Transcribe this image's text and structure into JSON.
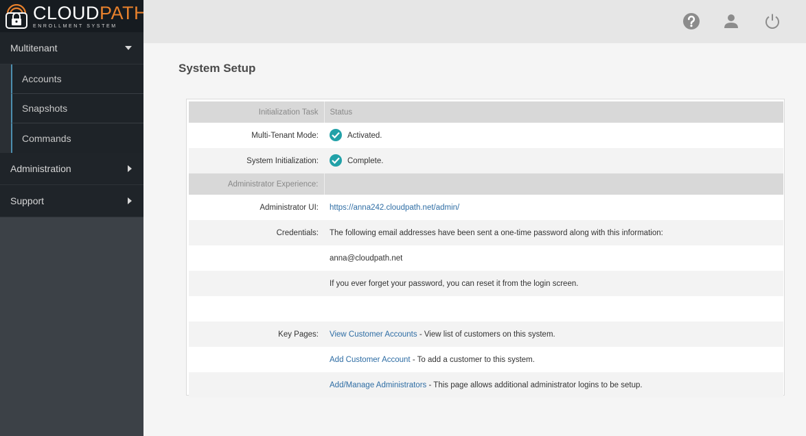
{
  "app": {
    "logo_main_a": "CLOUD",
    "logo_main_b": "PATH",
    "logo_sub": "ENROLLMENT SYSTEM",
    "accent_color": "#e9812c",
    "check_color": "#22a1a8"
  },
  "sidebar": {
    "multitenant": {
      "label": "Multitenant",
      "items": [
        {
          "label": "Accounts"
        },
        {
          "label": "Snapshots"
        },
        {
          "label": "Commands"
        }
      ]
    },
    "administration": {
      "label": "Administration"
    },
    "support": {
      "label": "Support"
    }
  },
  "topbar": {
    "icons": [
      "help-icon",
      "user-icon",
      "power-icon"
    ]
  },
  "page": {
    "title": "System Setup"
  },
  "setup_table": {
    "header": {
      "task": "Initialization Task",
      "status": "Status"
    },
    "multi_tenant": {
      "label": "Multi-Tenant Mode:",
      "value": "Activated."
    },
    "system_init": {
      "label": "System Initialization:",
      "value": "Complete."
    },
    "admin_header": {
      "label": "Administrator Experience:"
    },
    "admin_ui": {
      "label": "Administrator UI:",
      "link": "https://anna242.cloudpath.net/admin/"
    },
    "credentials": {
      "label": "Credentials:",
      "line1": "The following email addresses have been sent a one-time password along with this information:",
      "email": "anna@cloudpath.net",
      "line3": "If you ever forget your password, you can reset it from the login screen."
    },
    "key_pages": {
      "label": "Key Pages:",
      "items": [
        {
          "link": "View Customer Accounts",
          "desc": " - View list of customers on this system."
        },
        {
          "link": "Add Customer Account",
          "desc": " - To add a customer to this system."
        },
        {
          "link": "Add/Manage Administrators",
          "desc": " - This page allows additional administrator logins to be setup."
        }
      ]
    }
  }
}
